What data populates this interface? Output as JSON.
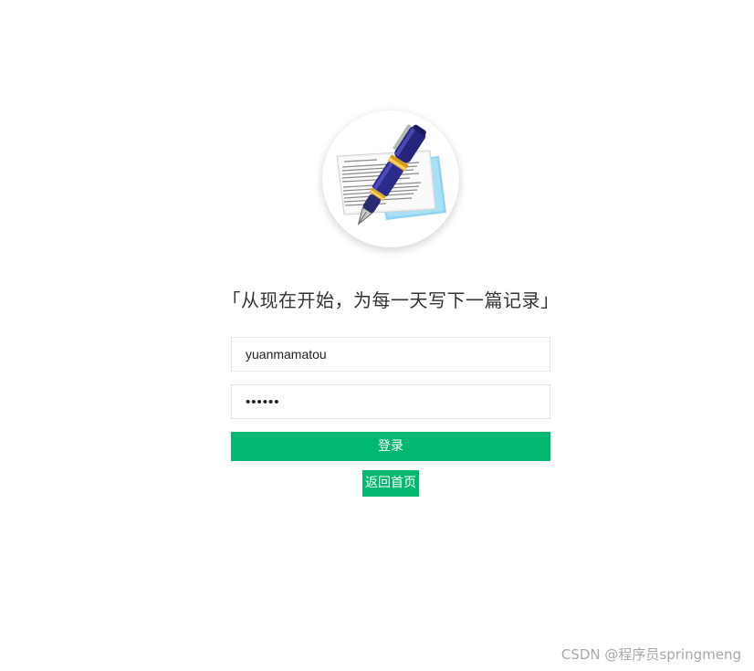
{
  "logo": {
    "icon": "pen-and-document-icon"
  },
  "slogan": "「从现在开始，为每一天写下一篇记录」",
  "form": {
    "username_value": "yuanmamatou",
    "password_value": "••••••",
    "login_label": "登录",
    "back_label": "返回首页"
  },
  "watermark": "CSDN @程序员springmeng",
  "colors": {
    "accent": "#00b86f",
    "input_border": "#e6e6e6",
    "text": "#333333",
    "watermark": "#a8a8a8"
  }
}
